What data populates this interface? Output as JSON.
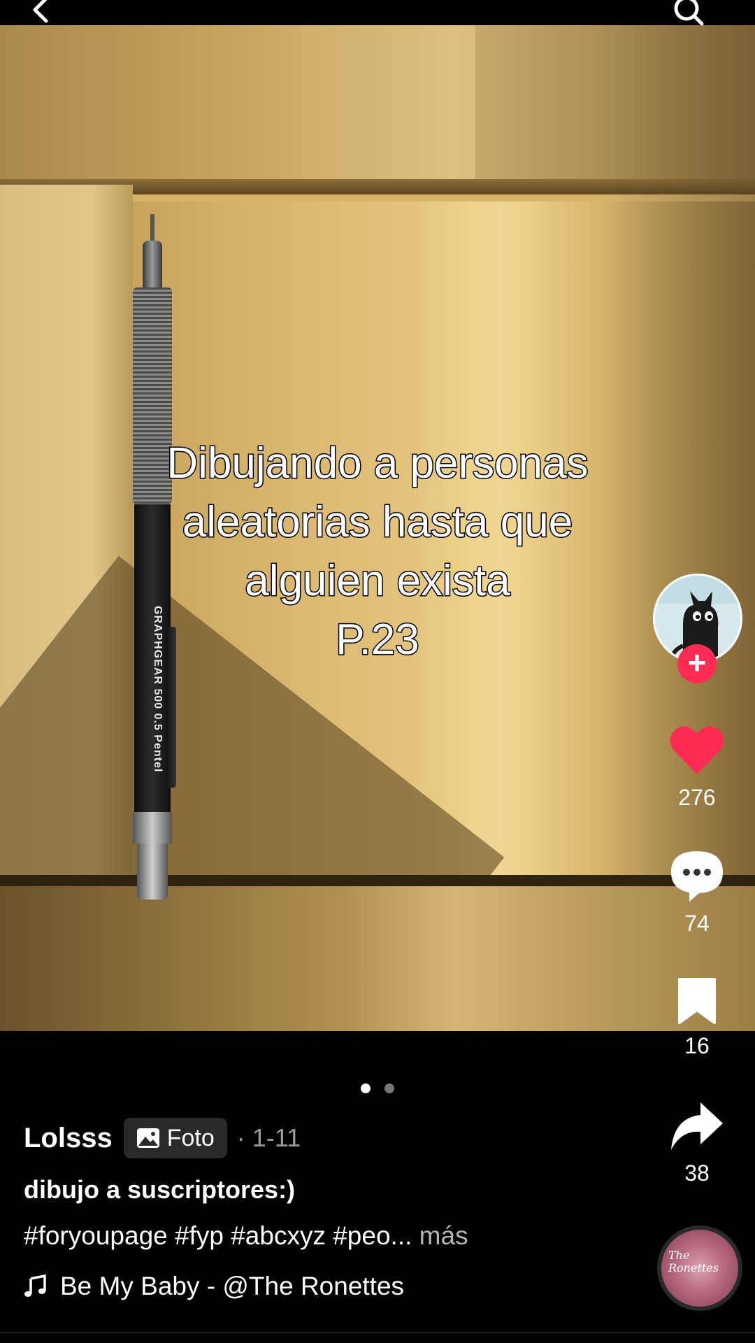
{
  "overlay": {
    "lines": [
      "Dibujando a personas",
      "aleatorias hasta que",
      "alguien exista",
      "P.23"
    ]
  },
  "pencil": {
    "brand_text": "GRAPHGEAR 500  0.5 Pentel"
  },
  "actions": {
    "likes": "276",
    "comments": "74",
    "saves": "16",
    "shares": "38",
    "follow_glyph": "+"
  },
  "post": {
    "author": "Lolsss",
    "type_label": "Foto",
    "date": "· 1-11",
    "caption": "dibujo a suscriptores:)",
    "hashtags": "#foryoupage #fyp #abcxyz #peo...",
    "more": "más",
    "sound": "Be My Baby - @The Ronettes"
  },
  "music_disc_text": "The Ronettes",
  "pagination": {
    "total": 2,
    "active": 1
  },
  "colors": {
    "accent": "#fe2c55",
    "background": "#000000",
    "muted_text": "#9a9a9a"
  },
  "icons": [
    "back-icon",
    "search-icon",
    "heart-icon",
    "comment-icon",
    "bookmark-icon",
    "share-icon",
    "music-note-icon",
    "photo-icon"
  ]
}
